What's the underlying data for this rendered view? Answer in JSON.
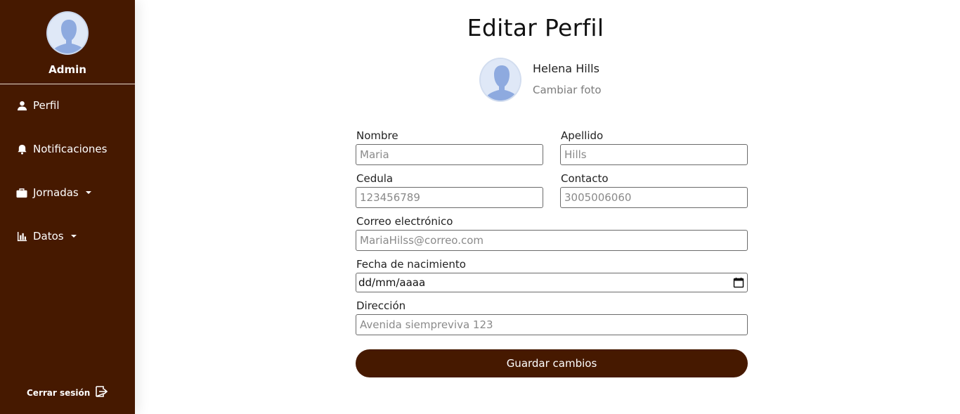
{
  "sidebar": {
    "role_label": "Admin",
    "items": [
      {
        "label": "Perfil",
        "icon": "user-icon"
      },
      {
        "label": "Notificaciones",
        "icon": "bell-icon"
      },
      {
        "label": "Jornadas",
        "icon": "briefcase-icon",
        "dropdown": true
      },
      {
        "label": "Datos",
        "icon": "bar-chart-icon",
        "dropdown": true
      }
    ],
    "logout_label": "Cerrar sesión",
    "logout_icon": "sign-out-icon",
    "background_color": "#461900"
  },
  "main": {
    "title": "Editar Perfil",
    "profile": {
      "name": "Helena Hills",
      "change_photo": "Cambiar foto"
    },
    "form": {
      "nombre": {
        "label": "Nombre",
        "placeholder": "Maria"
      },
      "apellido": {
        "label": "Apellido",
        "placeholder": "Hills"
      },
      "cedula": {
        "label": "Cedula",
        "placeholder": "123456789"
      },
      "contacto": {
        "label": "Contacto",
        "placeholder": "3005006060"
      },
      "correo": {
        "label": "Correo electrónico",
        "placeholder": "MariaHilss@correo.com"
      },
      "fecha": {
        "label": "Fecha de nacimiento",
        "value": "dd/mm/aaaa"
      },
      "direccion": {
        "label": "Dirección",
        "placeholder": "Avenida siempreviva 123"
      }
    },
    "save_label": "Guardar cambios",
    "accent_color": "#461900"
  }
}
